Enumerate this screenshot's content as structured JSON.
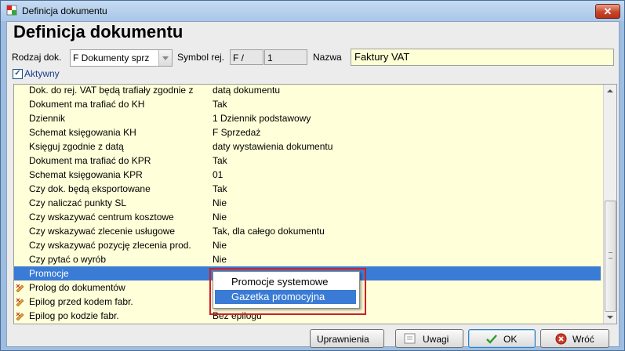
{
  "window": {
    "title": "Definicja dokumentu",
    "close_label": "✕"
  },
  "header": {
    "heading": "Definicja dokumentu"
  },
  "form": {
    "rodzaj_label": "Rodzaj dok.",
    "rodzaj_value": "F Dokumenty sprz",
    "symbol_label": "Symbol rej.",
    "symbol_value": "F /",
    "number_value": "1",
    "nazwa_label": "Nazwa",
    "nazwa_value": "Faktury VAT",
    "aktywny_label": "Aktywny",
    "aktywny_checked": true
  },
  "grid": {
    "rows": [
      {
        "label": "Dok. do rej. VAT będą trafiały zgodnie z",
        "value": "datą dokumentu"
      },
      {
        "label": "Dokument ma trafiać do KH",
        "value": "Tak"
      },
      {
        "label": "Dziennik",
        "value": "1 Dziennik podstawowy"
      },
      {
        "label": "Schemat księgowania KH",
        "value": "F   Sprzedaż"
      },
      {
        "label": "Księguj zgodnie z datą",
        "value": "daty wystawienia dokumentu"
      },
      {
        "label": "Dokument ma trafiać do KPR",
        "value": "Tak"
      },
      {
        "label": "Schemat księgowania KPR",
        "value": "01"
      },
      {
        "label": "Czy dok. będą eksportowane",
        "value": "Tak"
      },
      {
        "label": "Czy naliczać punkty SL",
        "value": "Nie"
      },
      {
        "label": "Czy wskazywać centrum kosztowe",
        "value": "Nie"
      },
      {
        "label": "Czy wskazywać zlecenie usługowe",
        "value": "Tak, dla całego dokumentu"
      },
      {
        "label": "Czy wskazywać pozycję zlecenia prod.",
        "value": "Nie"
      },
      {
        "label": "Czy pytać o wyrób",
        "value": "Nie"
      },
      {
        "label": "Promocje",
        "value": ""
      },
      {
        "label": "Prolog do dokumentów",
        "value": ""
      },
      {
        "label": "Epilog przed kodem fabr.",
        "value": ""
      },
      {
        "label": "Epilog po kodzie fabr.",
        "value": "Bez epilogu"
      }
    ]
  },
  "popup": {
    "items": [
      "Promocje systemowe",
      "Gazetka promocyjna"
    ]
  },
  "buttons": {
    "uprawnienia": "Uprawnienia",
    "uwagi": "Uwagi",
    "ok": "OK",
    "wroc": "Wróć"
  },
  "colors": {
    "selection": "#3a7bd5",
    "grid_bg": "#ffffd9",
    "highlight_border": "#d12020"
  }
}
